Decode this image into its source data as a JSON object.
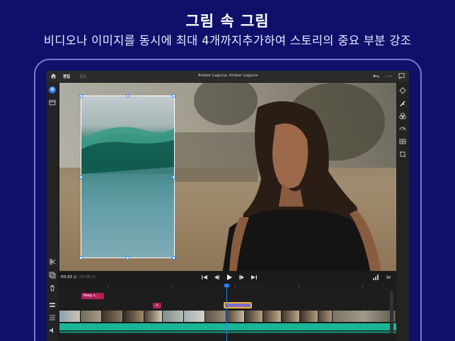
{
  "promo": {
    "headline": "그림 속 그림",
    "subline": "비디오나 이미지를 동시에 최대 4개까지추가하여 스토리의 중요 부분 강조"
  },
  "topbar": {
    "home_icon": "home-icon",
    "tab_edit": "편집",
    "tab_share": "공유",
    "project_title": "Amber Laguna: Amber Laguna",
    "undo_icon": "undo-icon",
    "redo_icon": "redo-icon",
    "comment_icon": "comment-icon"
  },
  "leftbar": {
    "add_label": "+",
    "icons": [
      "add-media-icon",
      "library-icon",
      "split-icon",
      "duplicate-icon",
      "delete-icon",
      "tracks-icon",
      "list-icon",
      "volume-icon"
    ]
  },
  "rightbar": {
    "icons": [
      "shape-icon",
      "color-icon",
      "effects-icon",
      "speed-icon",
      "crop-icon",
      "transform-icon"
    ]
  },
  "transport": {
    "current_time": "00:33",
    "current_frames": "11",
    "duration": "00:56",
    "duration_frames": "29"
  },
  "timeline": {
    "title_clip_label": "Keep s...",
    "mini_clip_label": "<"
  },
  "colors": {
    "background": "#10106b",
    "accent": "#2d7ff9",
    "title_clip": "#b01f5a",
    "overlay_clip": "#7e6ec9",
    "audio": "#1fc9a6"
  }
}
